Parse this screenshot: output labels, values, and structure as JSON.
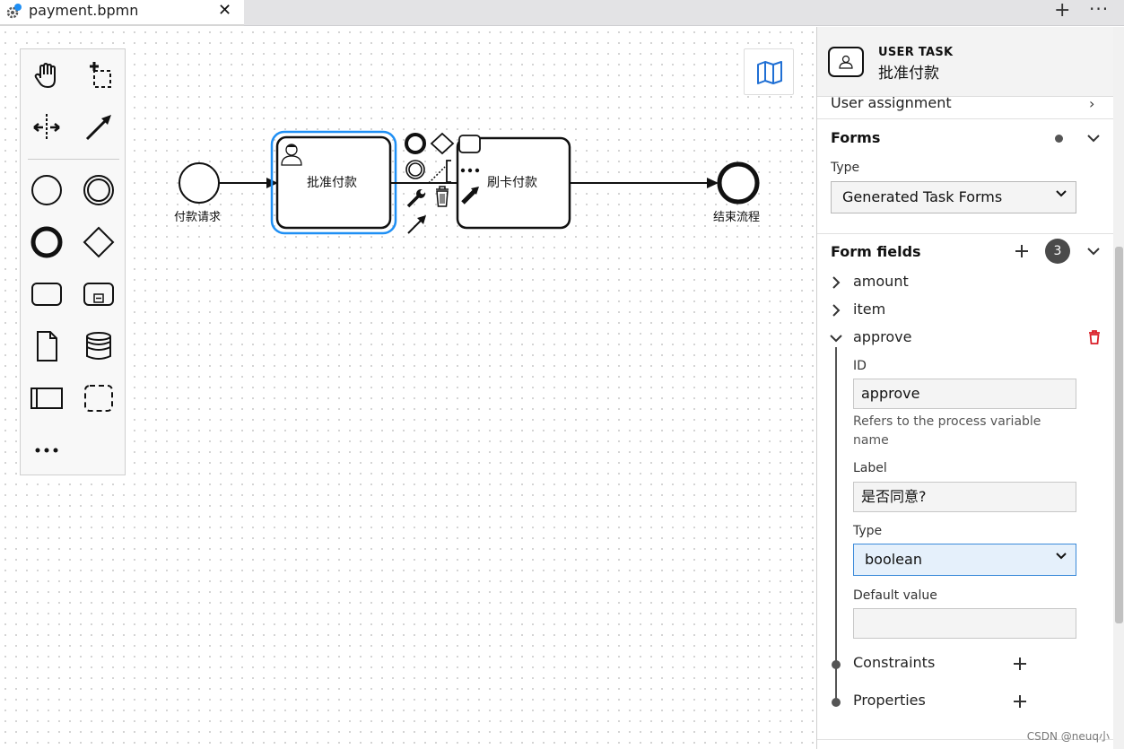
{
  "tab": {
    "title": "payment.bpmn",
    "close_glyph": "✕",
    "add_glyph": "+",
    "more_glyph": "···"
  },
  "palette": {
    "tools": [
      "hand-tool",
      "lasso-tool",
      "space-tool",
      "connect-tool",
      "start-event",
      "intermediate-event",
      "end-event",
      "gateway",
      "task",
      "subprocess",
      "data-object",
      "data-store",
      "pool",
      "group",
      "more"
    ]
  },
  "diagram": {
    "start_label": "付款请求",
    "task1_label": "批准付款",
    "task2_label": "刷卡付款",
    "end_label": "结束流程",
    "selection_color": "#1f8ff4"
  },
  "panel": {
    "element_type": "USER TASK",
    "element_name": "批准付款",
    "user_assignment": "User assignment",
    "forms_title": "Forms",
    "type_label": "Type",
    "forms_type_value": "Generated Task Forms",
    "form_fields_title": "Form fields",
    "form_fields_count": "3",
    "fields": [
      "amount",
      "item",
      "approve"
    ],
    "id_label": "ID",
    "id_value": "approve",
    "id_hint": "Refers to the process variable name",
    "label_label": "Label",
    "label_value": "是否同意?",
    "field_type_label": "Type",
    "field_type_value": "boolean",
    "default_label": "Default value",
    "default_value": "",
    "constraints": "Constraints",
    "properties": "Properties",
    "delete_color": "#da1e28"
  },
  "watermark": "CSDN @neuq小"
}
